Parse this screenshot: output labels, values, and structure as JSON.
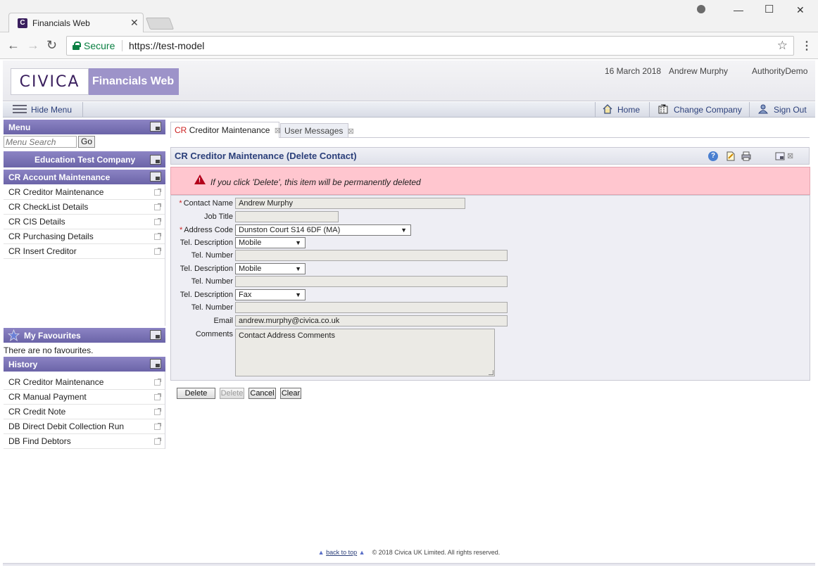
{
  "browser": {
    "tab_title": "Financials Web",
    "secure_label": "Secure",
    "url": "https://test-model"
  },
  "header": {
    "logo": "CIVICA",
    "product": "Financials Web",
    "date": "16 March 2018",
    "user": "Andrew Murphy",
    "authority": "AuthorityDemo"
  },
  "topnav": {
    "hide_menu": "Hide Menu",
    "home": "Home",
    "change_company": "Change Company",
    "sign_out": "Sign Out"
  },
  "sidebar": {
    "menu_title": "Menu",
    "search_placeholder": "Menu Search",
    "go_label": "Go",
    "company": "Education Test Company",
    "section": "CR Account Maintenance",
    "items": [
      {
        "label": "CR Creditor Maintenance"
      },
      {
        "label": "CR CheckList Details"
      },
      {
        "label": "CR CIS Details"
      },
      {
        "label": "CR Purchasing Details"
      },
      {
        "label": "CR Insert Creditor"
      }
    ],
    "favourites_title": "My Favourites",
    "favourites_empty": "There are no favourites.",
    "history_title": "History",
    "history": [
      {
        "label": "CR Creditor Maintenance"
      },
      {
        "label": "CR Manual Payment"
      },
      {
        "label": "CR Credit Note"
      },
      {
        "label": "DB Direct Debit Collection Run"
      },
      {
        "label": "DB Find Debtors"
      }
    ]
  },
  "tabs": {
    "active_prefix": "CR",
    "active_label": "Creditor Maintenance",
    "inactive_label": "User Messages"
  },
  "form": {
    "title": "CR Creditor Maintenance (Delete Contact)",
    "warning": "If you click 'Delete', this item will be permanently deleted",
    "labels": {
      "contact_name": "Contact Name",
      "job_title": "Job Title",
      "address_code": "Address Code",
      "tel_description": "Tel. Description",
      "tel_number": "Tel. Number",
      "email": "Email",
      "comments": "Comments"
    },
    "values": {
      "contact_name": "Andrew Murphy",
      "job_title": "",
      "address_code": "Dunston Court S14 6DF (MA)",
      "tel_description_1": "Mobile",
      "tel_number_1": "",
      "tel_description_2": "Mobile",
      "tel_number_2": "",
      "tel_description_3": "Fax",
      "tel_number_3": "",
      "email": "andrew.murphy@civica.co.uk",
      "comments": "Contact Address Comments"
    },
    "buttons": {
      "delete": "Delete",
      "delete_disabled": "Delete",
      "cancel": "Cancel",
      "clear": "Clear"
    }
  },
  "footer": {
    "back_to_top": "back to top",
    "copyright": "© 2018 Civica UK Limited. All rights reserved."
  }
}
